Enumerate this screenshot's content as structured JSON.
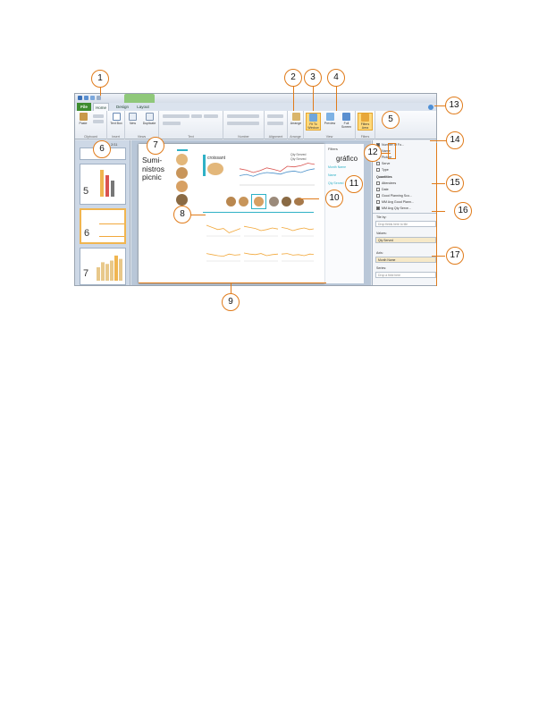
{
  "window": {
    "tabs": [
      "File",
      "Home",
      "Design",
      "Layout"
    ],
    "ribbon_groups": [
      "Clipboard",
      "Insert",
      "Views",
      "Text",
      "Number",
      "Alignment",
      "Arrange",
      "View",
      "Filters"
    ],
    "ribbon_buttons": {
      "paste": "Paste",
      "text_box": "Text Box",
      "new": "New",
      "duplicate": "Duplicate",
      "arrange": "Arrange",
      "fit_to_window": "Fit To Window",
      "preview": "Preview",
      "full_screen": "Full Screen",
      "filters_area": "Filters Area"
    }
  },
  "thumbnails": {
    "header": "2/11",
    "items": [
      {
        "num": "5"
      },
      {
        "num": "6"
      },
      {
        "num": "7"
      }
    ]
  },
  "sheet": {
    "title": "Sumi-nistros picnic",
    "title_lines": [
      "Sumi-",
      "nistros",
      "picnic"
    ],
    "card_title": "croissant",
    "chart_title_overlay": "gráfico",
    "legend": [
      "Qty Served",
      "Qty Served"
    ]
  },
  "filters_panel": {
    "title": "Filters",
    "items": [
      "Month Name",
      "Name",
      "Qty Served"
    ]
  },
  "field_list": {
    "fields": [
      {
        "label": "Number of Fo...",
        "checked": true
      },
      {
        "label": "Name",
        "checked": true
      },
      {
        "label": "Picture",
        "checked": true
      },
      {
        "label": "Serve",
        "checked": false
      },
      {
        "label": "Type",
        "checked": false
      }
    ],
    "section_quantities": "Quantities",
    "quantity_fields": [
      {
        "label": "Attendees",
        "checked": false
      },
      {
        "label": "Date",
        "checked": false
      },
      {
        "label": "Good Planning Sco...",
        "checked": false
      },
      {
        "label": "MM Avg Good Plann...",
        "checked": false
      },
      {
        "label": "MM Avg Qty Serve...",
        "checked": true
      }
    ],
    "tile_by_label": "Tile by:",
    "tile_by_placeholder": "Drop fields here to tile",
    "values_label": "Values:",
    "values_value": "Qty Served",
    "axis_label": "Axis:",
    "axis_value": "Month Name",
    "series_label": "Series:",
    "series_placeholder": "Drop a field here"
  },
  "callouts": [
    "1",
    "2",
    "3",
    "4",
    "5",
    "6",
    "7",
    "8",
    "9",
    "10",
    "11",
    "12",
    "13",
    "14",
    "15",
    "16",
    "17"
  ],
  "colors": {
    "callout": "#e07b1a",
    "file_tab": "#3d8c2f",
    "accent_teal": "#2fb1c6",
    "line_orange": "#f2a83b",
    "line_red": "#d9534f",
    "line_blue": "#4a90c9"
  },
  "chart_data": [
    {
      "type": "line",
      "series": [
        {
          "name": "Qty Served",
          "values": [
            52,
            48,
            40,
            46,
            55,
            50,
            44,
            60,
            58,
            62,
            70,
            66
          ]
        },
        {
          "name": "Qty Served",
          "values": [
            30,
            34,
            28,
            36,
            40,
            38,
            35,
            42,
            45,
            40,
            48,
            52
          ]
        }
      ]
    },
    {
      "type": "line",
      "series": [
        {
          "values": [
            50,
            46,
            42,
            44,
            36,
            40,
            44
          ]
        },
        {
          "values": [
            48,
            46,
            44,
            40,
            42,
            45,
            43
          ]
        },
        {
          "values": [
            46,
            44,
            40,
            43,
            45,
            42,
            44
          ]
        },
        {
          "values": [
            44,
            42,
            40,
            39,
            43,
            41,
            42
          ]
        },
        {
          "values": [
            45,
            43,
            42,
            44,
            40,
            42,
            43
          ]
        },
        {
          "values": [
            43,
            44,
            41,
            42,
            40,
            43,
            42
          ]
        }
      ]
    },
    {
      "type": "bar",
      "values": [
        40,
        55,
        50,
        60,
        75,
        65
      ]
    }
  ]
}
